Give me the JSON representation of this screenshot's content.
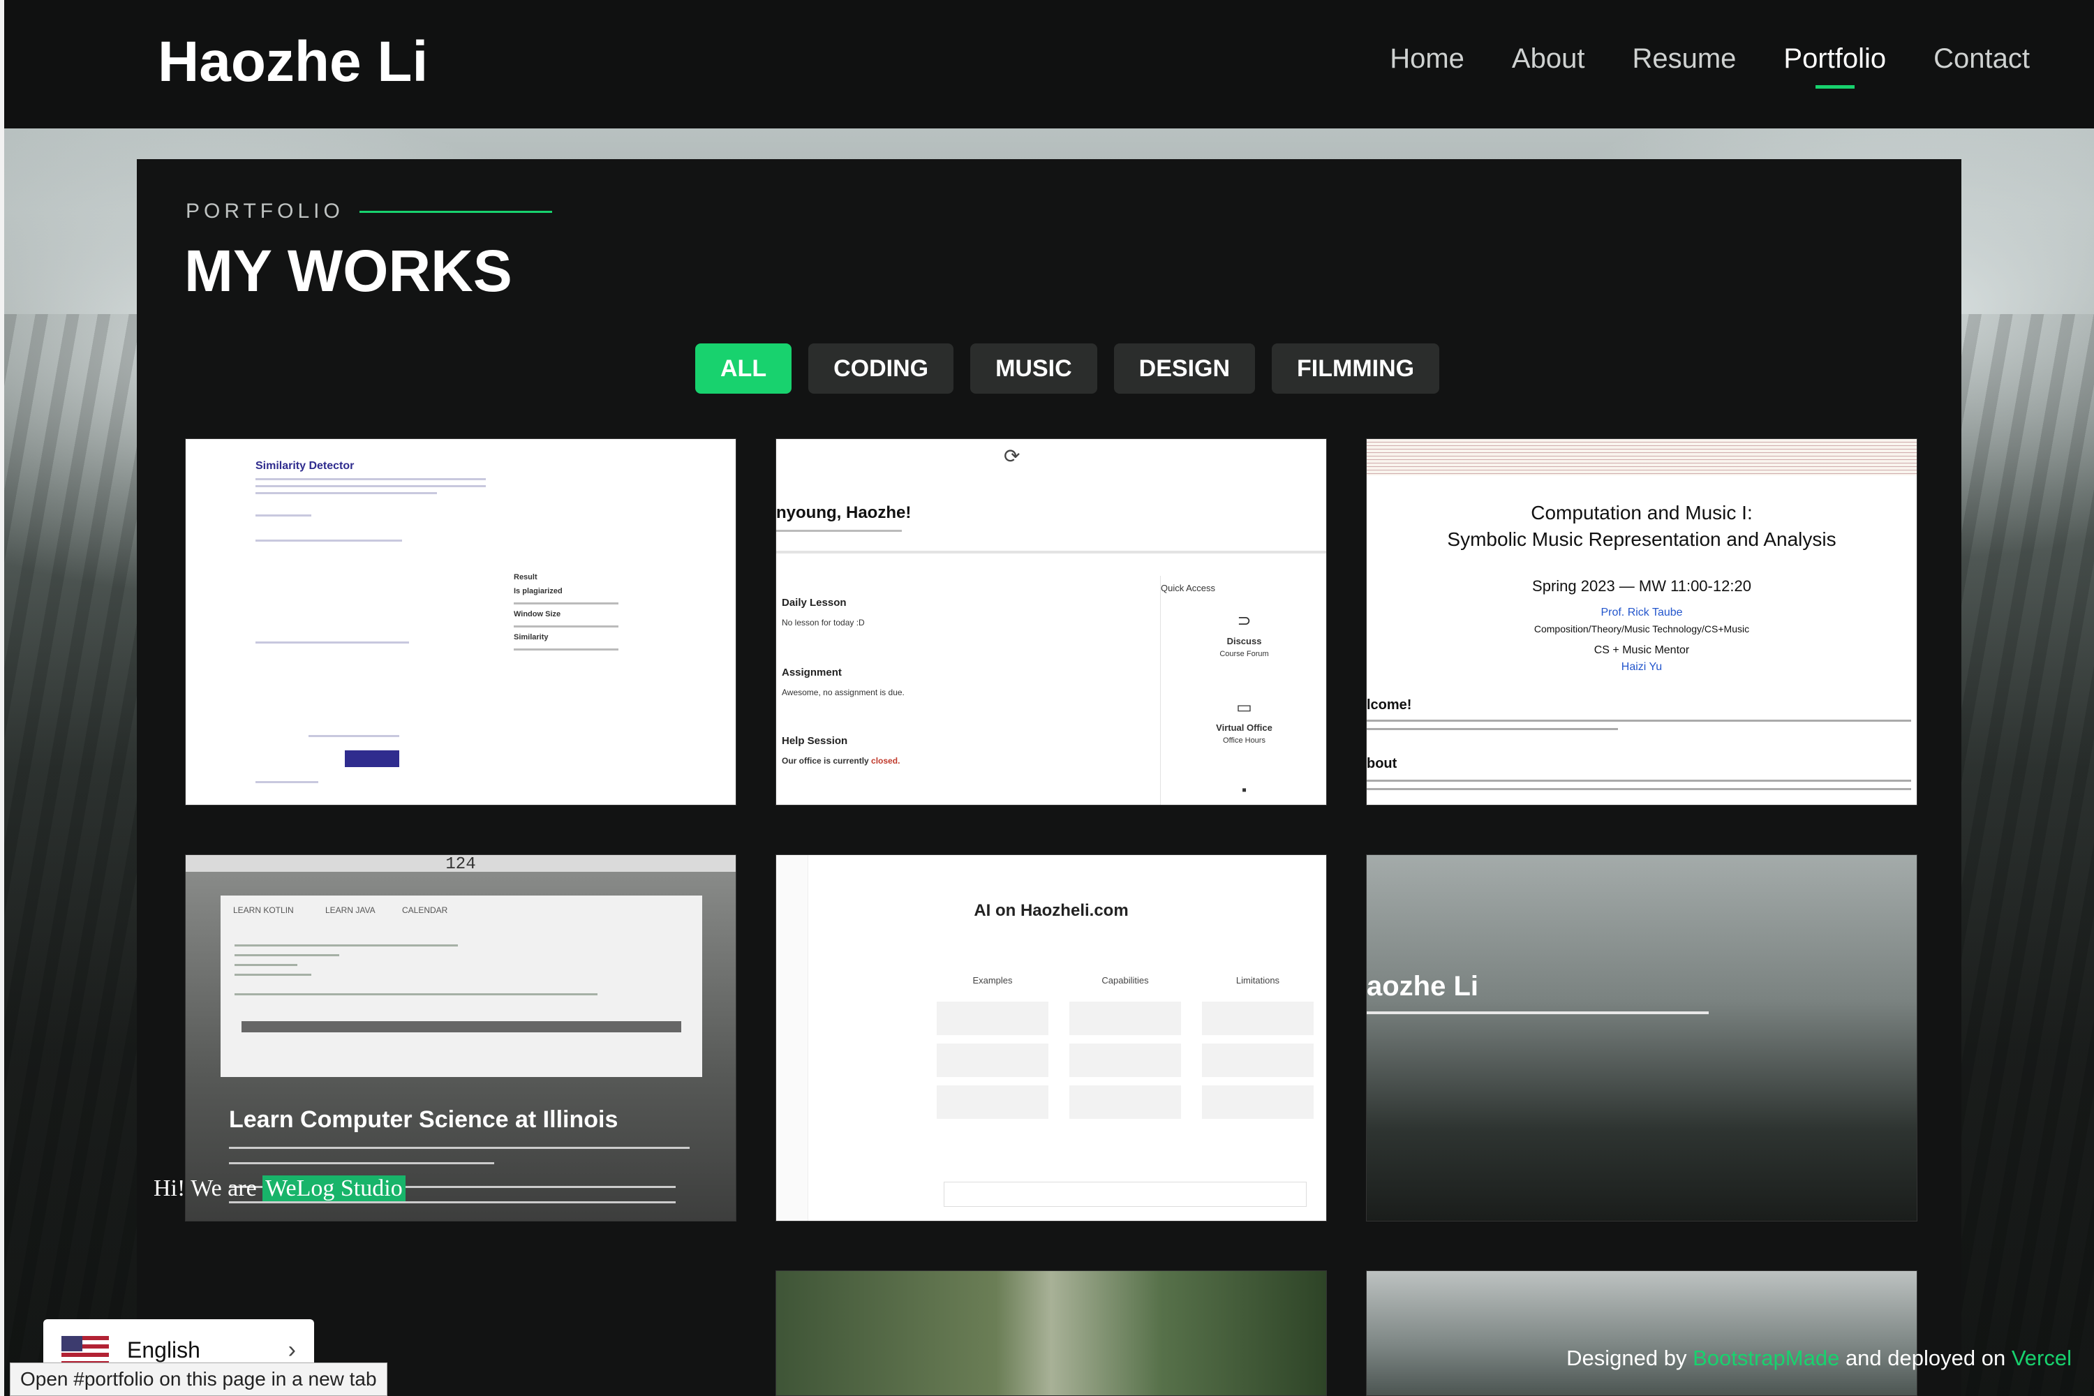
{
  "header": {
    "brand": "Haozhe Li",
    "nav": [
      "Home",
      "About",
      "Resume",
      "Portfolio",
      "Contact"
    ],
    "active": "Portfolio"
  },
  "section": {
    "eyebrow": "PORTFOLIO",
    "title": "MY WORKS"
  },
  "filters": [
    "ALL",
    "CODING",
    "MUSIC",
    "DESIGN",
    "FILMMING"
  ],
  "cards": {
    "similarity": {
      "title": "Similarity Detector",
      "result": "Result",
      "labels": [
        "Is plagiarized",
        "Window Size",
        "Similarity"
      ]
    },
    "annyeong": {
      "greeting": "nyoung, Haozhe!",
      "daily": "Daily Lesson",
      "no_lesson": "No lesson for today :D",
      "assignment": "Assignment",
      "no_assignment": "Awesome, no assignment is due.",
      "help": "Help Session",
      "office": "Our office is currently",
      "closed": "closed.",
      "quick": "Quick Access",
      "discuss": "Discuss",
      "forum": "Course Forum",
      "virtual": "Virtual Office",
      "hours": "Office Hours"
    },
    "music": {
      "title1": "Computation and Music I:",
      "title2": "Symbolic Music Representation and Analysis",
      "term": "Spring 2023 — MW 11:00-12:20",
      "prof": "Prof. Rick Taube",
      "dept": "Composition/Theory/Music Technology/CS+Music",
      "mentor": "CS + Music Mentor",
      "mentor_name": "Haizi Yu",
      "welcome": "lcome!",
      "about": "bout"
    },
    "cs124": {
      "number": "124",
      "tabs": [
        "LEARN KOTLIN",
        "LEARN JAVA",
        "CALENDAR"
      ],
      "heading": "Learn Computer Science at Illinois"
    },
    "ai": {
      "heading": "AI on Haozheli.com",
      "cols": [
        "Examples",
        "Capabilities",
        "Limitations"
      ]
    },
    "landing": {
      "name": "aozhe Li"
    }
  },
  "welog": {
    "prefix": "Hi!  We are ",
    "name": "WeLog Studio"
  },
  "language": {
    "label": "English"
  },
  "status_text": "Open #portfolio on this page in a new tab",
  "footer": {
    "designed": "Designed by ",
    "bootstrap": "BootstrapMade",
    "deployed": " and deployed on ",
    "vercel": "Vercel"
  },
  "colors": {
    "accent": "#18d26e",
    "background": "#121313"
  }
}
